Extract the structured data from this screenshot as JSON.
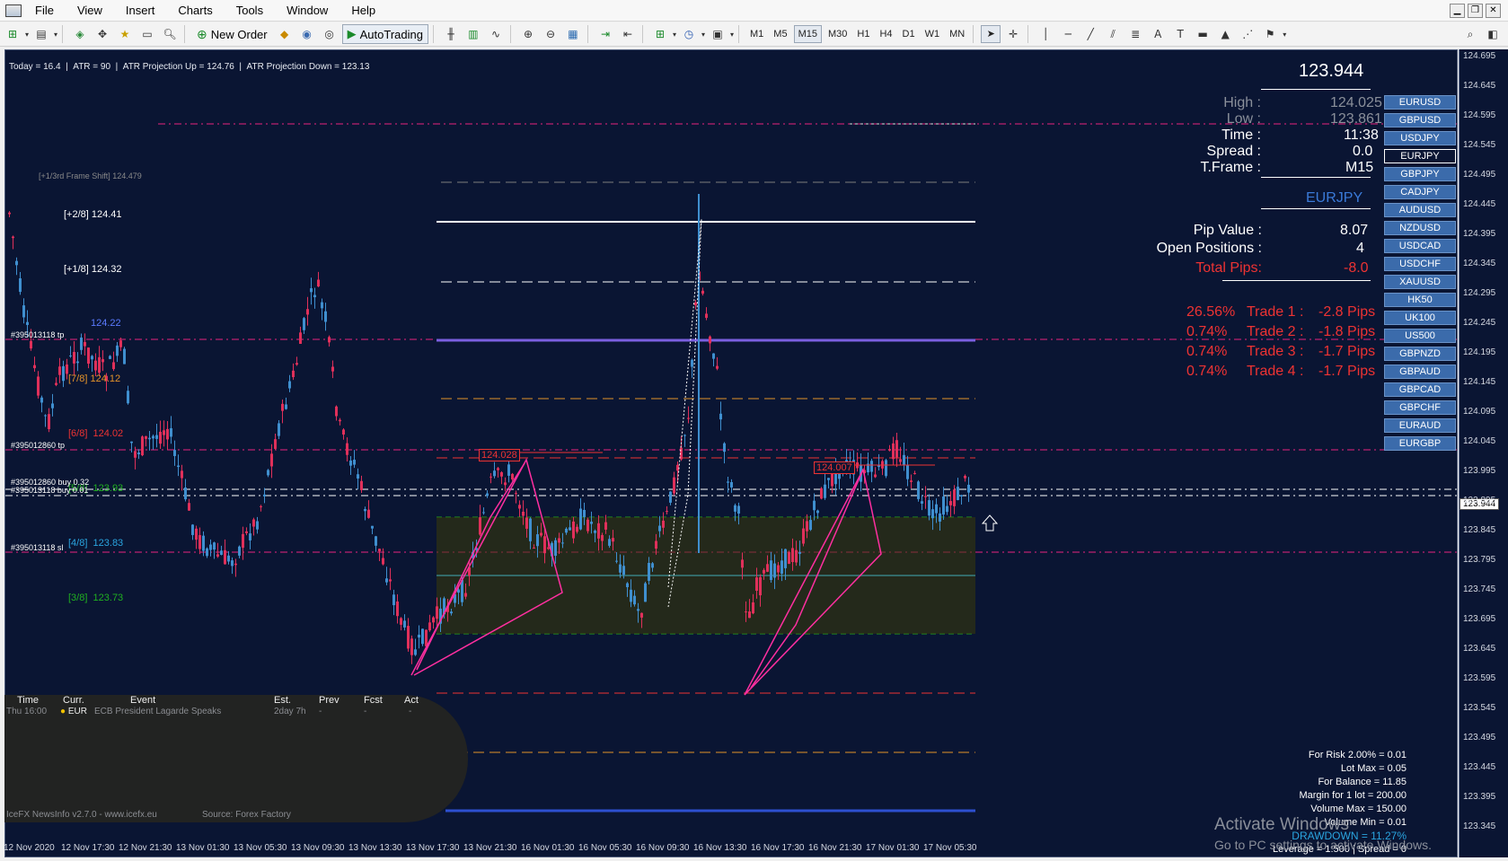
{
  "menu": [
    "File",
    "View",
    "Insert",
    "Charts",
    "Tools",
    "Window",
    "Help"
  ],
  "toolbar": {
    "new_order": "New Order",
    "autotrading": "AutoTrading",
    "timeframes": [
      "M1",
      "M5",
      "M15",
      "M30",
      "H1",
      "H4",
      "D1",
      "W1",
      "MN"
    ],
    "active_timeframe": "M15"
  },
  "atr": {
    "today": "Today = 16.4",
    "atr": "ATR = 90",
    "proj_up": "ATR Projection Up = 124.76",
    "proj_down": "ATR Projection Down = 123.13"
  },
  "levels": {
    "frame_shift": "[+1/3rd Frame Shift]  124.479",
    "p28": "[+2/8]  124.41",
    "p18": "[+1/8]  124.32",
    "l88": "124.22",
    "l78": "[7/8]  124.12",
    "l68_a": "[6/8]",
    "l68_b": "124.02",
    "l58_a": "[5/8]",
    "l58_b": "123.93",
    "l48_a": "[4/8]",
    "l48_b": "123.83",
    "l38_a": "[3/8]",
    "l38_b": "123.73"
  },
  "order_labels": {
    "tp1": "#395013118 tp",
    "tp2": "#395012860 tp",
    "buy1": "#395012860 buy 0.32",
    "buy2": "#395013118 buy 0.01",
    "sl": "#395013118 sl"
  },
  "pattern_labels": {
    "left": "124.028",
    "right": "124.007"
  },
  "info": {
    "bid": "123.944",
    "high_label": "High :",
    "high": "124.025",
    "low_label": "Low :",
    "low": "123.861",
    "time_label": "Time :",
    "time": "11:38",
    "spread_label": "Spread :",
    "spread": "0.0",
    "tf_label": "T.Frame :",
    "tf": "M15",
    "symbol": "EURJPY",
    "pip_label": "Pip Value :",
    "pip": "8.07",
    "open_label": "Open Positions :",
    "open": "4",
    "total_label": "Total Pips:",
    "total": "-8.0",
    "trades": [
      {
        "pct": "26.56%",
        "name": "Trade 1 :",
        "pips": "-2.8 Pips"
      },
      {
        "pct": "0.74%",
        "name": "Trade 2 :",
        "pips": "-1.8 Pips"
      },
      {
        "pct": "0.74%",
        "name": "Trade 3 :",
        "pips": "-1.7 Pips"
      },
      {
        "pct": "0.74%",
        "name": "Trade 4 :",
        "pips": "-1.7 Pips"
      }
    ]
  },
  "symbols": [
    "EURUSD",
    "GBPUSD",
    "USDJPY",
    "EURJPY",
    "GBPJPY",
    "CADJPY",
    "AUDUSD",
    "NZDUSD",
    "USDCAD",
    "USDCHF",
    "XAUUSD",
    "HK50",
    "UK100",
    "US500",
    "GBPNZD",
    "GBPAUD",
    "GBPCAD",
    "GBPCHF",
    "EURAUD",
    "EURGBP"
  ],
  "active_symbol": "EURJPY",
  "news": {
    "headers": [
      "Time",
      "Curr.",
      "Event",
      "Est.",
      "Prev",
      "Fcst",
      "Act"
    ],
    "row": {
      "time": "Thu  16:00",
      "curr": "EUR",
      "event": "ECB President Lagarde Speaks",
      "est": "2day 7h",
      "prev": "-",
      "fcst": "-",
      "act": "-"
    },
    "footer_left": "IceFX NewsInfo v2.7.0  -  www.icefx.eu",
    "footer_right": "Source: Forex Factory"
  },
  "risk": [
    "For Risk 2.00% = 0.01",
    "Lot Max = 0.05",
    "For Balance = 11.85",
    "Margin for 1 lot = 200.00",
    "Volume Max = 150.00",
    "Volume Min = 0.01",
    "DRAWDOWN =  11.27%",
    "Leverage = 1:500 | Spread = 0"
  ],
  "activate": {
    "title": "Activate Windows",
    "sub": "Go to PC settings to activate Windows."
  },
  "price_scale": [
    "124.695",
    "124.645",
    "124.595",
    "124.545",
    "124.495",
    "124.445",
    "124.395",
    "124.345",
    "124.295",
    "124.245",
    "124.195",
    "124.145",
    "124.095",
    "124.045",
    "123.995",
    "123.944",
    "123.895",
    "123.845",
    "123.795",
    "123.745",
    "123.695",
    "123.645",
    "123.595",
    "123.545",
    "123.495",
    "123.445",
    "123.395",
    "123.345"
  ],
  "current_price": "123.944",
  "time_axis": [
    "12 Nov 2020",
    "12 Nov 17:30",
    "12 Nov 21:30",
    "13 Nov 01:30",
    "13 Nov 05:30",
    "13 Nov 09:30",
    "13 Nov 13:30",
    "13 Nov 17:30",
    "13 Nov 21:30",
    "16 Nov 01:30",
    "16 Nov 05:30",
    "16 Nov 09:30",
    "16 Nov 13:30",
    "16 Nov 17:30",
    "16 Nov 21:30",
    "17 Nov 01:30",
    "17 Nov 05:30"
  ]
}
